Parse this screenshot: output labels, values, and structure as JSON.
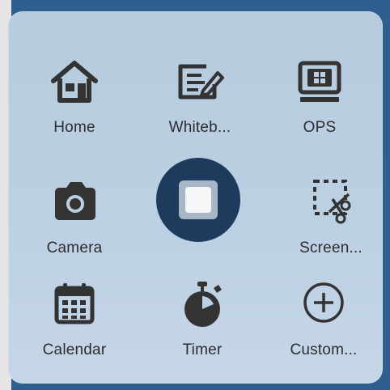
{
  "menu": {
    "items": [
      {
        "label": "Home",
        "icon": "home-icon"
      },
      {
        "label": "Whiteb...",
        "icon": "whiteboard-icon"
      },
      {
        "label": "OPS",
        "icon": "ops-icon"
      },
      {
        "label": "Camera",
        "icon": "camera-icon"
      },
      {
        "label": "Screen...",
        "icon": "screenshot-icon"
      },
      {
        "label": "Calendar",
        "icon": "calendar-icon"
      },
      {
        "label": "Timer",
        "icon": "timer-icon"
      },
      {
        "label": "Custom...",
        "icon": "add-icon"
      }
    ],
    "center_button": {
      "icon": "stop-icon"
    }
  },
  "colors": {
    "background": "#2f5f8f",
    "panel": "#bcd0e3",
    "icon": "#333333",
    "center": "#1e3a5c"
  }
}
